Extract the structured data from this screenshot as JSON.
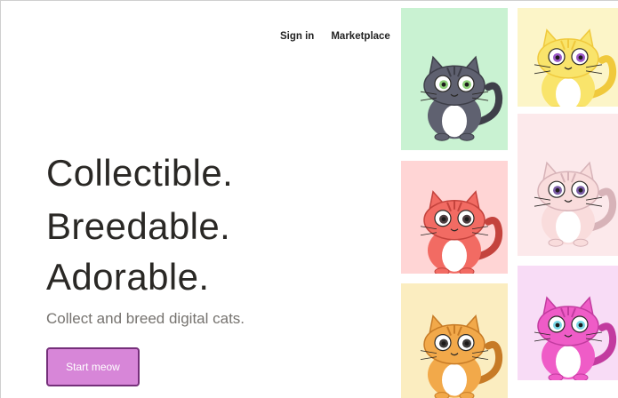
{
  "nav": {
    "sign_in": "Sign in",
    "marketplace": "Marketplace"
  },
  "hero": {
    "lines": [
      "Collectible.",
      "Breedable.",
      "Adorable."
    ],
    "tagline": "Collect and breed digital cats.",
    "cta": "Start meow"
  },
  "tiles": [
    {
      "name": "cat-tile-gray",
      "bg": "#c9f2d2",
      "body": "#5f6170",
      "accent": "#3e3f49",
      "belly": "#ffffff",
      "eye": "#8fd17a"
    },
    {
      "name": "cat-tile-yellow",
      "bg": "#fcf5c8",
      "body": "#f9e46b",
      "accent": "#f0c93c",
      "belly": "#ffffff",
      "eye": "#9b59c7"
    },
    {
      "name": "cat-tile-red",
      "bg": "#ffd5d5",
      "body": "#f26b63",
      "accent": "#c4433d",
      "belly": "#ffffff",
      "eye": "#4d3d40"
    },
    {
      "name": "cat-tile-pink",
      "bg": "#fce9eb",
      "body": "#f9dcdc",
      "accent": "#d7b3b8",
      "belly": "#ffffff",
      "eye": "#7a5ca6"
    },
    {
      "name": "cat-tile-orange",
      "bg": "#fbedc0",
      "body": "#f2a94a",
      "accent": "#c77b26",
      "belly": "#ffffff",
      "eye": "#3d3b3a"
    },
    {
      "name": "cat-tile-magenta",
      "bg": "#f8dcf6",
      "body": "#ef5cc7",
      "accent": "#c23b9f",
      "belly": "#ffffff",
      "eye": "#7ad8e6"
    }
  ]
}
